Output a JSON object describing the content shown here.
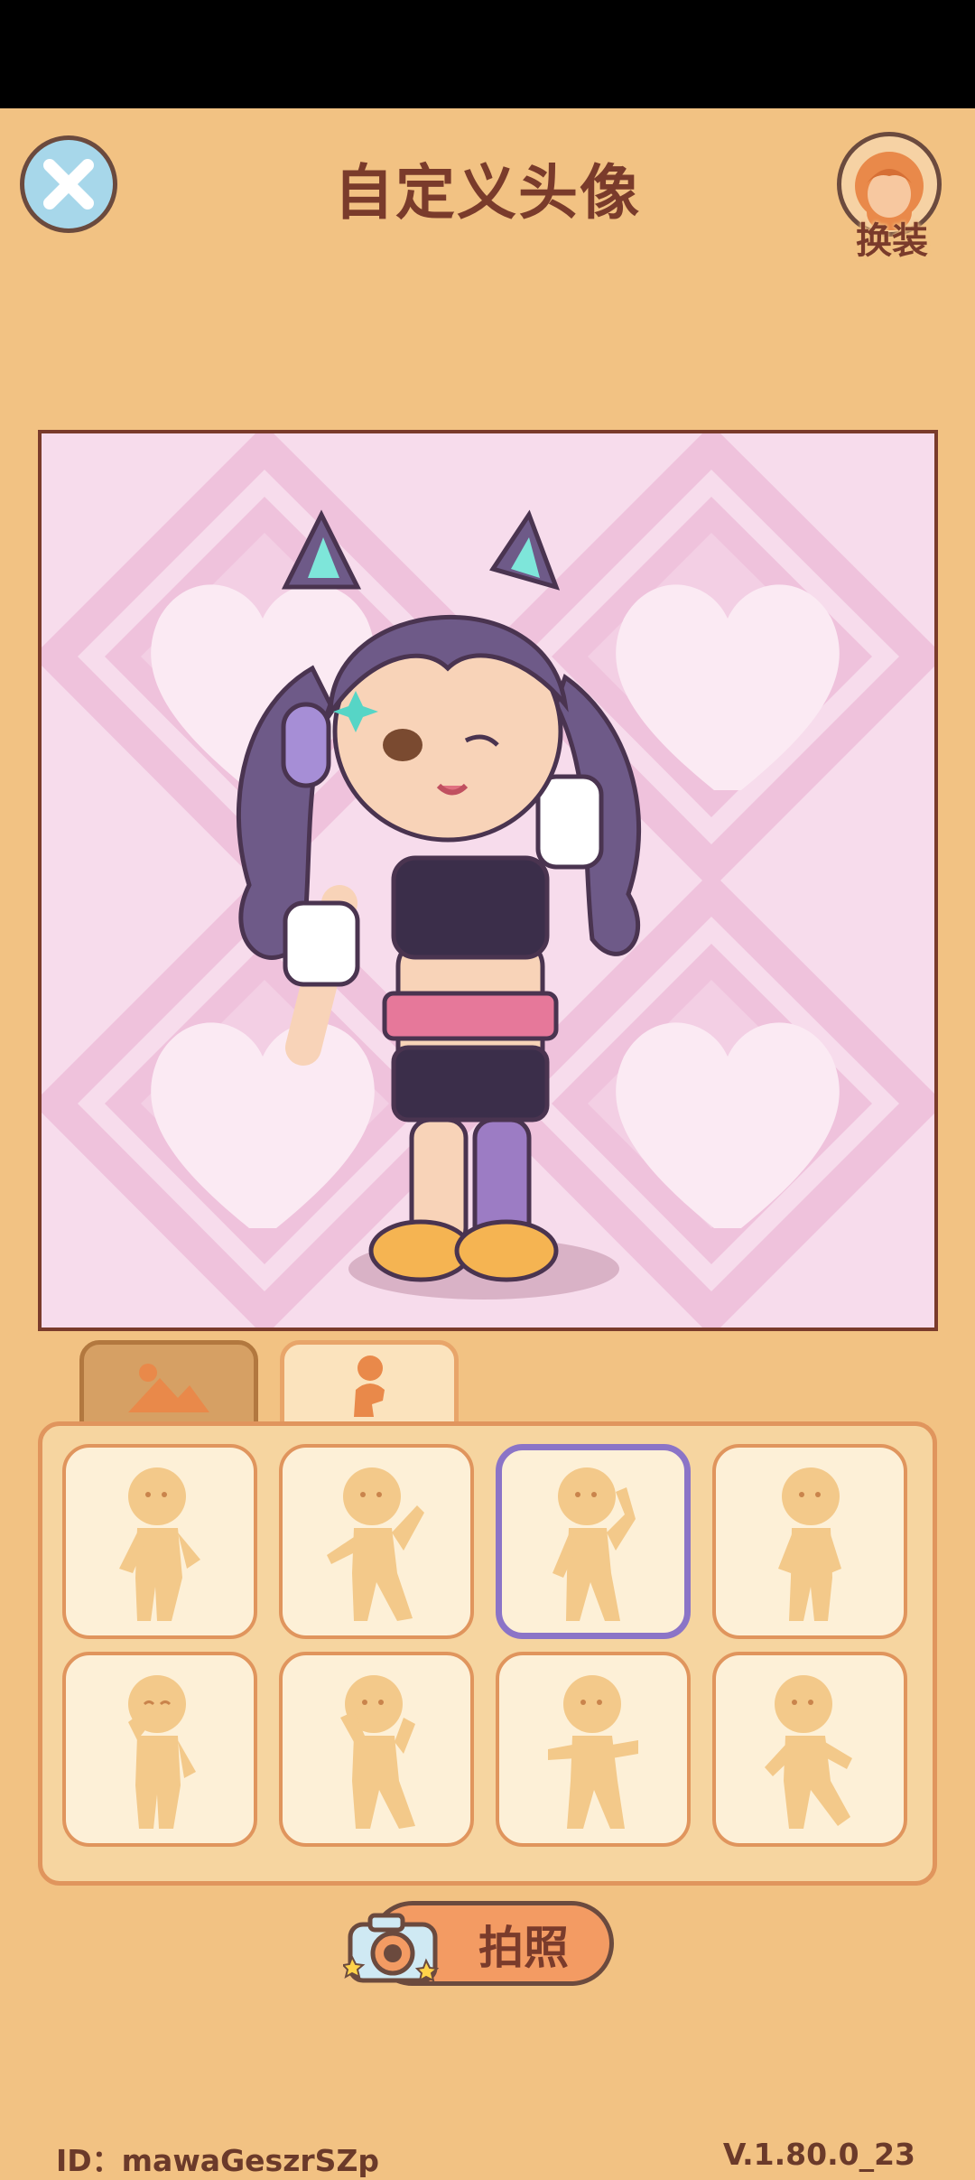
{
  "header": {
    "title": "自定义头像",
    "dress_label": "换装"
  },
  "tabs": [
    {
      "name": "background",
      "icon": "mountain-icon",
      "active": true
    },
    {
      "name": "pose",
      "icon": "person-icon",
      "active": false
    }
  ],
  "poses": {
    "count": 8,
    "selected_index": 2,
    "items": [
      {
        "icon": "pose-1-icon"
      },
      {
        "icon": "pose-2-icon"
      },
      {
        "icon": "pose-3-icon"
      },
      {
        "icon": "pose-4-icon"
      },
      {
        "icon": "pose-5-icon"
      },
      {
        "icon": "pose-6-icon"
      },
      {
        "icon": "pose-7-icon"
      },
      {
        "icon": "pose-8-icon"
      }
    ]
  },
  "photo_button": {
    "label": "拍照",
    "icon": "camera-icon"
  },
  "footer": {
    "id_text": "ID：mawaGeszrSZp",
    "version": "V.1.80.0_23"
  },
  "colors": {
    "page_bg": "#f2c283",
    "title_brown": "#7a3b2b",
    "selected_border": "#8b74c7",
    "canvas_pink": "#f7dcec"
  }
}
